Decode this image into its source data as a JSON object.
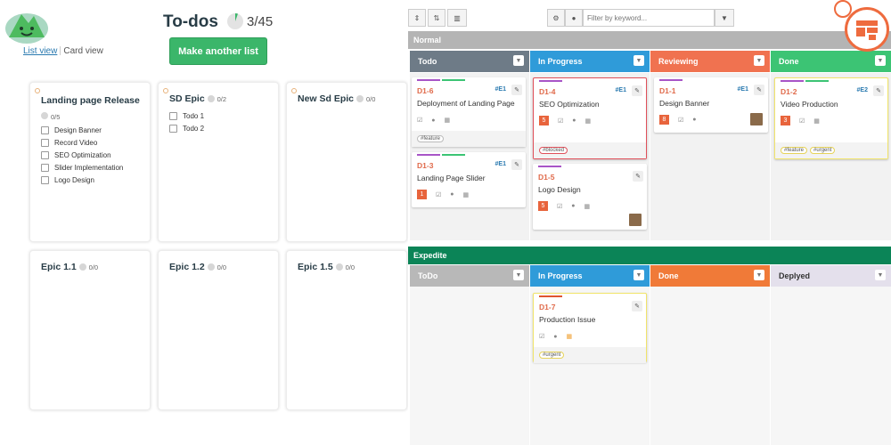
{
  "left": {
    "views": {
      "list": "List view",
      "card": "Card view"
    },
    "title": "To-dos",
    "count": "3/45",
    "make_button": "Make another list",
    "lists": [
      {
        "title": "Landing page Release",
        "count": "0/5",
        "items": [
          "Design Banner",
          "Record Video",
          "SEO Optimization",
          "Slider Implementation",
          "Logo Design"
        ]
      },
      {
        "title": "SD Epic",
        "count": "0/2",
        "items": [
          "Todo 1",
          "Todo 2"
        ]
      },
      {
        "title": "New Sd Epic",
        "count": "0/0",
        "items": []
      },
      {
        "title": "Epic 1.1",
        "count": "0/0",
        "items": []
      },
      {
        "title": "Epic 1.2",
        "count": "0/0",
        "items": []
      },
      {
        "title": "Epic 1.5",
        "count": "0/0",
        "items": []
      }
    ]
  },
  "right": {
    "filter_placeholder": "Filter by keyword...",
    "swimlanes": [
      {
        "name": "Normal",
        "color": "#b4b4b4",
        "columns": [
          {
            "name": "Todo",
            "color": "#6e7b87"
          },
          {
            "name": "In Progress",
            "color": "#2f9bd9"
          },
          {
            "name": "Reviewing",
            "color": "#f07250"
          },
          {
            "name": "Done",
            "color": "#3cc474"
          }
        ]
      },
      {
        "name": "Expedite",
        "color": "#0b8457",
        "columns": [
          {
            "name": "ToDo",
            "color": "#b8b8b8"
          },
          {
            "name": "In Progress",
            "color": "#2f9bd9"
          },
          {
            "name": "Done",
            "color": "#f07a38"
          },
          {
            "name": "Deplyed",
            "color": "#e4e0ec"
          }
        ]
      }
    ],
    "cards": [
      {
        "id": "D1-6",
        "tag": "#E1",
        "title": "Deployment of Landing Page",
        "points": "",
        "labels": [
          "#feature"
        ]
      },
      {
        "id": "D1-3",
        "tag": "#E1",
        "title": "Landing Page Slider",
        "points": "1",
        "labels": []
      },
      {
        "id": "D1-4",
        "tag": "#E1",
        "title": "SEO Optimization",
        "points": "5",
        "labels": [
          "#blocked"
        ]
      },
      {
        "id": "D1-5",
        "tag": "",
        "title": "Logo Design",
        "points": "5",
        "labels": []
      },
      {
        "id": "D1-1",
        "tag": "#E1",
        "title": "Design Banner",
        "points": "8",
        "labels": []
      },
      {
        "id": "D1-2",
        "tag": "#E2",
        "title": "Video Production",
        "points": "3",
        "labels": [
          "#feature",
          "#urgent"
        ]
      },
      {
        "id": "D1-7",
        "tag": "",
        "title": "Production Issue",
        "points": "",
        "labels": [
          "#urgent"
        ]
      }
    ]
  }
}
